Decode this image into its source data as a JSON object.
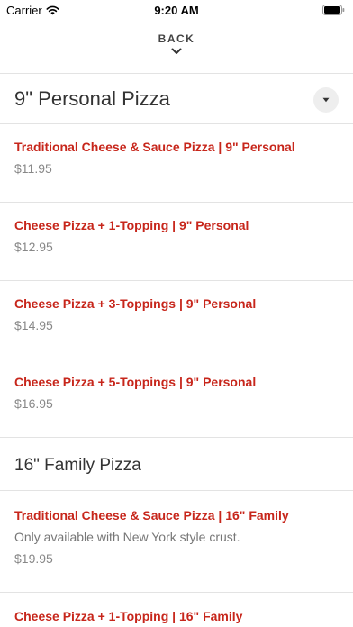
{
  "status": {
    "carrier": "Carrier",
    "time": "9:20 AM",
    "wifi_icon": "wifi-icon",
    "battery_icon": "battery-icon"
  },
  "nav": {
    "back_label": "BACK",
    "chevron_icon": "chevron-down-icon"
  },
  "sections": [
    {
      "title": "9\" Personal Pizza",
      "dropdown_icon": "dropdown-triangle-icon",
      "items": [
        {
          "name": "Traditional Cheese & Sauce Pizza | 9\" Personal",
          "price": "$11.95"
        },
        {
          "name": "Cheese Pizza + 1-Topping | 9\" Personal",
          "price": "$12.95"
        },
        {
          "name": "Cheese Pizza + 3-Toppings | 9\" Personal",
          "price": "$14.95"
        },
        {
          "name": "Cheese Pizza + 5-Toppings | 9\" Personal",
          "price": "$16.95"
        }
      ]
    },
    {
      "title": "16\" Family Pizza",
      "items": [
        {
          "name": "Traditional Cheese & Sauce Pizza | 16\" Family",
          "description": "Only available with New York style crust.",
          "price": "$19.95"
        },
        {
          "name": "Cheese Pizza + 1-Topping | 16\" Family"
        }
      ]
    }
  ],
  "colors": {
    "item_name": "#c7261b",
    "price": "#888888",
    "divider": "#e3e3e3"
  }
}
